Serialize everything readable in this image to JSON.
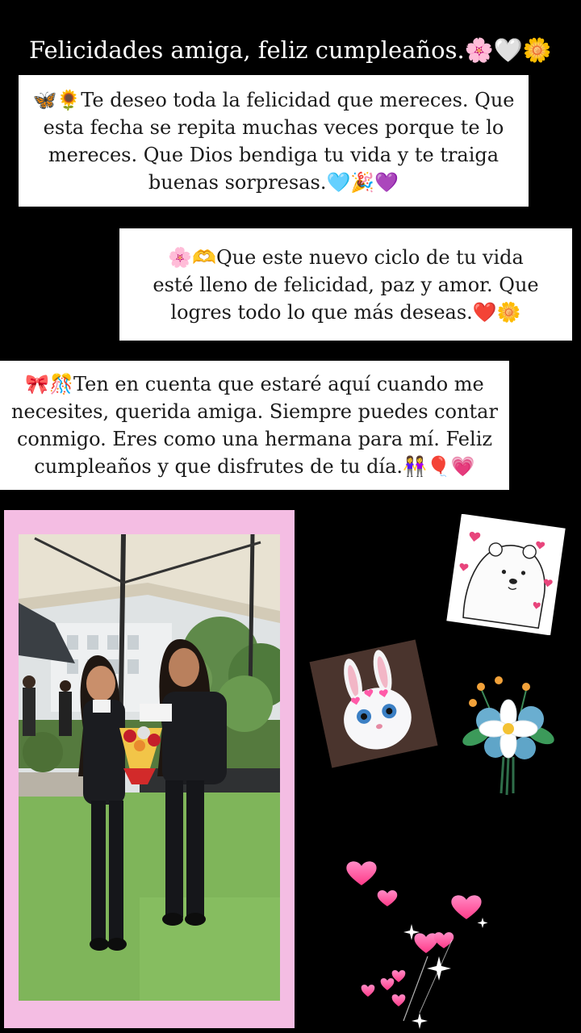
{
  "title": "Felicidades amiga, feliz cumpleaños.🌸🤍🌼",
  "messages": [
    {
      "lines": [
        "🦋🌻Te deseo toda la felicidad que mereces. Que",
        "esta fecha se repita muchas veces porque te lo",
        "mereces. Que Dios bendiga tu vida y te traiga",
        "buenas sorpresas.🩵🎉💜"
      ]
    },
    {
      "lines": [
        "🌸🫶Que este nuevo ciclo de tu vida",
        "esté lleno de felicidad, paz y amor. Que",
        "logres todo lo que más deseas.❤️🌼"
      ]
    },
    {
      "lines": [
        "🎀🎊Ten en cuenta que estaré aquí cuando me",
        "necesites, querida amiga. Siempre puedes contar",
        "conmigo. Eres como una hermana para mí. Feliz",
        "cumpleaños y que disfrutes de tu día.👭🎈💗"
      ]
    }
  ],
  "colors": {
    "background": "#000000",
    "card": "#ffffff",
    "frame": "#f4bde3",
    "heart": "#ff4f9a"
  },
  "stickers": [
    "polar-bear-sticker",
    "bunny-sticker",
    "bouquet-sticker",
    "hearts-sparkles-sticker"
  ]
}
